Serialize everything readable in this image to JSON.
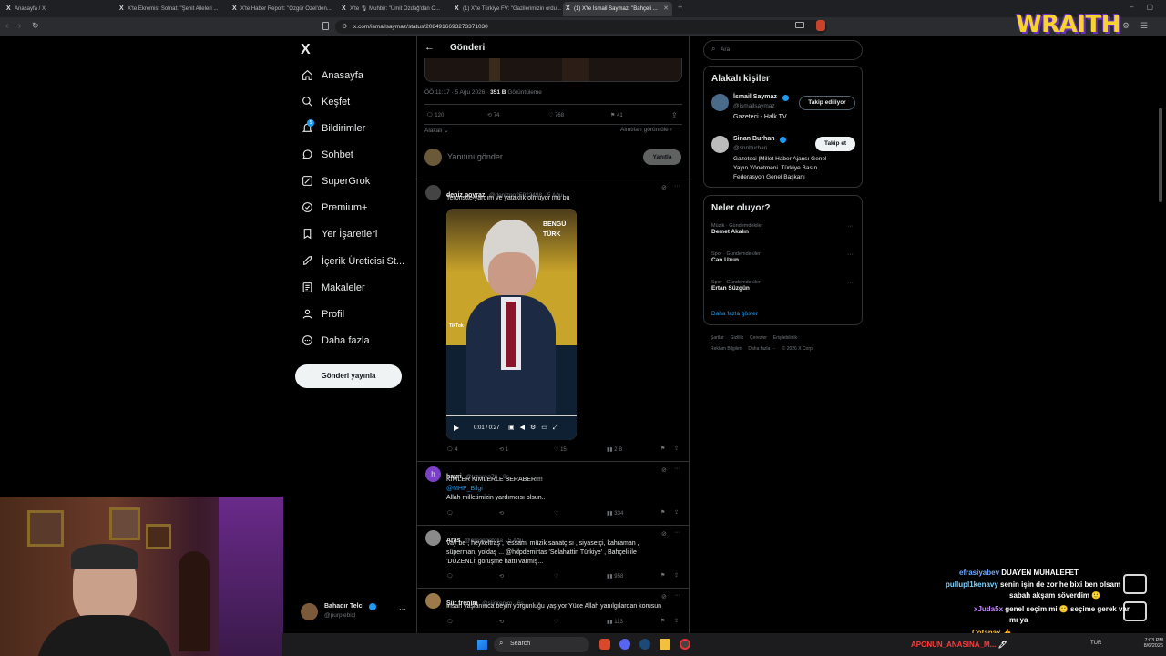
{
  "browser": {
    "tabs": [
      {
        "label": "Anasayfa / X"
      },
      {
        "label": "X'te Ekremist Sotnat: \"Şehit Aileleri ..."
      },
      {
        "label": "X'te Haber Report: \"Özgür Özel'den..."
      },
      {
        "label": "X'te 🎙 Muhbir: \"Ümit Özdağ'dan O..."
      },
      {
        "label": "(1) X'te Türkiye FV: \"Gazilerimizin ordu..."
      },
      {
        "label": "(1) X'te İsmail Saymaz: \"Bahçeli ..."
      }
    ],
    "url": "x.com/ismailsaymaz/status/2084916693273371030",
    "new_tab": "+"
  },
  "stream_overlay": {
    "brand": "WRAITH"
  },
  "sidebar": {
    "logo": "X",
    "items": [
      {
        "label": "Anasayfa",
        "icon": "home-icon"
      },
      {
        "label": "Keşfet",
        "icon": "search-icon"
      },
      {
        "label": "Bildirimler",
        "icon": "bell-icon",
        "badge": "5"
      },
      {
        "label": "Sohbet",
        "icon": "chat-icon"
      },
      {
        "label": "SuperGrok",
        "icon": "grok-icon"
      },
      {
        "label": "Premium+",
        "icon": "premium-icon"
      },
      {
        "label": "Yer İşaretleri",
        "icon": "bookmark-icon"
      },
      {
        "label": "İçerik Üreticisi St...",
        "icon": "rocket-icon"
      },
      {
        "label": "Makaleler",
        "icon": "article-icon"
      },
      {
        "label": "Profil",
        "icon": "profile-icon"
      },
      {
        "label": "Daha fazla",
        "icon": "more-icon"
      }
    ],
    "post_button": "Gönderi yayınla",
    "account": {
      "name": "Bahadır Telci",
      "handle": "@purplebixl"
    }
  },
  "main": {
    "header_title": "Gönderi",
    "post_meta": "ÖÖ 11:17 · 5 Ağu 2026 · ",
    "post_views": "351 B",
    "post_views_label": " Görüntüleme",
    "stats": {
      "replies": "120",
      "reposts": "74",
      "likes": "768",
      "bookmarks": "41"
    },
    "sort_label": "Alakalı",
    "related_link": "Alıntıları görüntüle",
    "reply_placeholder": "Yanıtını gönder",
    "reply_button": "Yanıtla",
    "replies": [
      {
        "name": "deniz poyraz",
        "handle": "@denizpo25922498 · 5 Ağu",
        "text": "Teroristte yardım ve yataklık olmuyor mu bu",
        "video": {
          "time": "0:01 / 0:27",
          "watermark": "TikTok",
          "overlay": "BENGÜ TÜRK"
        },
        "stats": {
          "replies": "4",
          "reposts": "1",
          "likes": "15",
          "views": "2 B"
        }
      },
      {
        "name": "hayri",
        "handle": "@torosya76 · 9s",
        "lines": [
          "KİMLER KİMLERLE BERABER!!!!",
          "@MHP_Bilgi",
          "Allah milletimizin yardımcısı olsun.."
        ],
        "stats": {
          "views": "334"
        }
      },
      {
        "name": "Aras",
        "handle": "@arasanatolia · 5 Ağu",
        "lines": [
          "Vay be , heykeltraş , ressam, müzik sanatçısı , siyasetçi, kahraman ,",
          "süperman, yoldaş ... @hdpdemirtas 'Selahattin Türkiye' , Bahçeli ile",
          "'DÜZENLİ' görüşme hattı varmış..."
        ],
        "stats": {
          "views": "958"
        }
      },
      {
        "name": "Şiir trenim",
        "handle": "@siirtrenim · 6s",
        "text": "İnsan yaşlanınca beyin yorgunluğu yaşıyor Yüce Allah yanılgılardan korusun",
        "stats": {
          "views": "113"
        }
      }
    ]
  },
  "right": {
    "search_placeholder": "Ara",
    "related_title": "Alakalı kişiler",
    "people": [
      {
        "name": "İsmail Saymaz",
        "handle": "@ismailsaymaz",
        "bio": "Gazeteci - Halk TV",
        "button": "Takip ediliyor"
      },
      {
        "name": "Sinan Burhan",
        "handle": "@snnburhan",
        "bio_lines": [
          "Gazeteci |Millet Haber Ajansı Genel",
          "Yayın Yönetmeni. Türkiye Basın",
          "Federasyon Genel Başkanı"
        ],
        "button": "Takip et"
      }
    ],
    "trends_title": "Neler oluyor?",
    "trends": [
      {
        "category": "Müzik · Gündemdekiler",
        "name": "Demet Akalın"
      },
      {
        "category": "Spor · Gündemdekiler",
        "name": "Can Uzun"
      },
      {
        "category": "Spor · Gündemdekiler",
        "name": "Ertan Süzgün"
      }
    ],
    "show_more": "Daha fazla göster",
    "footer_lines": [
      "Şartlar     Gizlilik     Çerezler     Erişilebilirlik",
      "Reklam Bilgileri     Daha fazla ···     © 2026 X Corp."
    ]
  },
  "chat": [
    {
      "user": "efrasiyabev",
      "msg": "DUAYEN MUHALEFET",
      "color": "#6ea8ff"
    },
    {
      "user": "pullupl1kenavy",
      "msg": "senin işin de zor he bixi ben olsam",
      "color": "#7fd3ff"
    },
    {
      "user": "",
      "msg": "sabah akşam söverdim 🙂",
      "color": "#7fd3ff"
    },
    {
      "user": "xJuda5x",
      "msg": "genel seçim mi 🙂 seçime gerek var",
      "color": "#c78bff"
    },
    {
      "user": "",
      "msg": "mı ya",
      "color": "#c78bff"
    },
    {
      "user": "Cotanax",
      "msg": "👍",
      "color": "#f5c242"
    },
    {
      "user": "APONUN_ANASINA_M...",
      "msg": "🖊",
      "color": "#ff3b3b"
    }
  ],
  "taskbar": {
    "search": "Search",
    "lang": "TUR",
    "time": "7:03 PM",
    "date": "8/6/2026"
  }
}
